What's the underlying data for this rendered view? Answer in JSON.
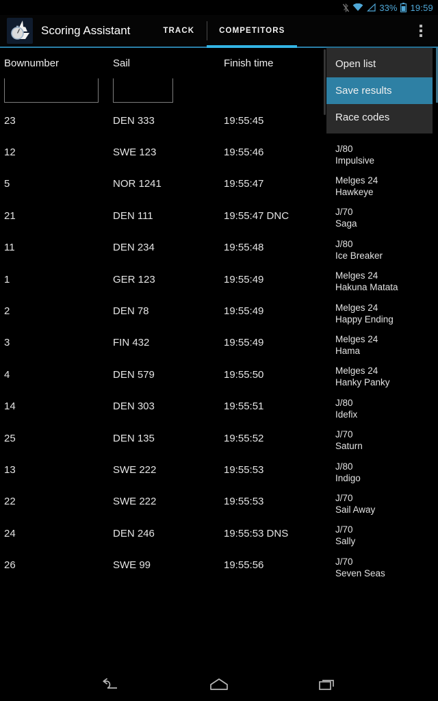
{
  "statusbar": {
    "icons": [
      "bluetooth-off-icon",
      "wifi-icon",
      "signal-icon",
      "battery-icon"
    ],
    "battery_percent": "33%",
    "clock": "19:59",
    "accent": "#4fa8d8"
  },
  "actionbar": {
    "logo": "sailboat-stopwatch-logo",
    "title": "Scoring Assistant",
    "tabs": [
      {
        "label": "TRACK",
        "active": false
      },
      {
        "label": "COMPETITORS",
        "active": true
      }
    ],
    "overflow": "overflow-menu-icon",
    "accent": "#33b5e5"
  },
  "table": {
    "headers": [
      "Bownumber",
      "Sail",
      "Finish time"
    ],
    "filters": [
      {
        "name": "bownumber-filter",
        "value": "",
        "placeholder": ""
      },
      {
        "name": "sail-filter",
        "value": "",
        "placeholder": ""
      }
    ],
    "rows": [
      {
        "bownumber": "23",
        "sail": "DEN 333",
        "finish_time": "19:55:45"
      },
      {
        "bownumber": "12",
        "sail": "SWE 123",
        "finish_time": "19:55:46"
      },
      {
        "bownumber": "5",
        "sail": "NOR 1241",
        "finish_time": "19:55:47"
      },
      {
        "bownumber": "21",
        "sail": "DEN 111",
        "finish_time": "19:55:47 DNC"
      },
      {
        "bownumber": "11",
        "sail": "DEN 234",
        "finish_time": "19:55:48"
      },
      {
        "bownumber": "1",
        "sail": "GER 123",
        "finish_time": "19:55:49"
      },
      {
        "bownumber": "2",
        "sail": "DEN 78",
        "finish_time": "19:55:49"
      },
      {
        "bownumber": "3",
        "sail": "FIN 432",
        "finish_time": "19:55:49"
      },
      {
        "bownumber": "4",
        "sail": "DEN 579",
        "finish_time": "19:55:50"
      },
      {
        "bownumber": "14",
        "sail": "DEN 303",
        "finish_time": "19:55:51"
      },
      {
        "bownumber": "25",
        "sail": "DEN 135",
        "finish_time": "19:55:52"
      },
      {
        "bownumber": "13",
        "sail": "SWE 222",
        "finish_time": "19:55:53"
      },
      {
        "bownumber": "22",
        "sail": "SWE 222",
        "finish_time": "19:55:53"
      },
      {
        "bownumber": "24",
        "sail": "DEN 246",
        "finish_time": "19:55:53 DNS"
      },
      {
        "bownumber": "26",
        "sail": "SWE 99",
        "finish_time": "19:55:56"
      }
    ]
  },
  "menu": {
    "highlight_color": "#2e80a4",
    "items": [
      {
        "label": "Open list",
        "selected": false
      },
      {
        "label": "Save results",
        "selected": true
      },
      {
        "label": "Race codes",
        "selected": false
      }
    ]
  },
  "competitors": [
    {
      "class": "J/80",
      "name": "Impulsive"
    },
    {
      "class": "Melges 24",
      "name": "Hawkeye"
    },
    {
      "class": "J/70",
      "name": "Saga"
    },
    {
      "class": "J/80",
      "name": "Ice Breaker"
    },
    {
      "class": "Melges 24",
      "name": "Hakuna Matata"
    },
    {
      "class": "Melges 24",
      "name": "Happy Ending"
    },
    {
      "class": "Melges 24",
      "name": "Hama"
    },
    {
      "class": "Melges 24",
      "name": "Hanky Panky"
    },
    {
      "class": "J/80",
      "name": "Idefix"
    },
    {
      "class": "J/70",
      "name": "Saturn"
    },
    {
      "class": "J/80",
      "name": "Indigo"
    },
    {
      "class": "J/70",
      "name": "Sail Away"
    },
    {
      "class": "J/70",
      "name": "Sally"
    },
    {
      "class": "J/70",
      "name": "Seven Seas"
    }
  ],
  "navbar": {
    "buttons": [
      "back-icon",
      "home-icon",
      "recents-icon"
    ]
  }
}
